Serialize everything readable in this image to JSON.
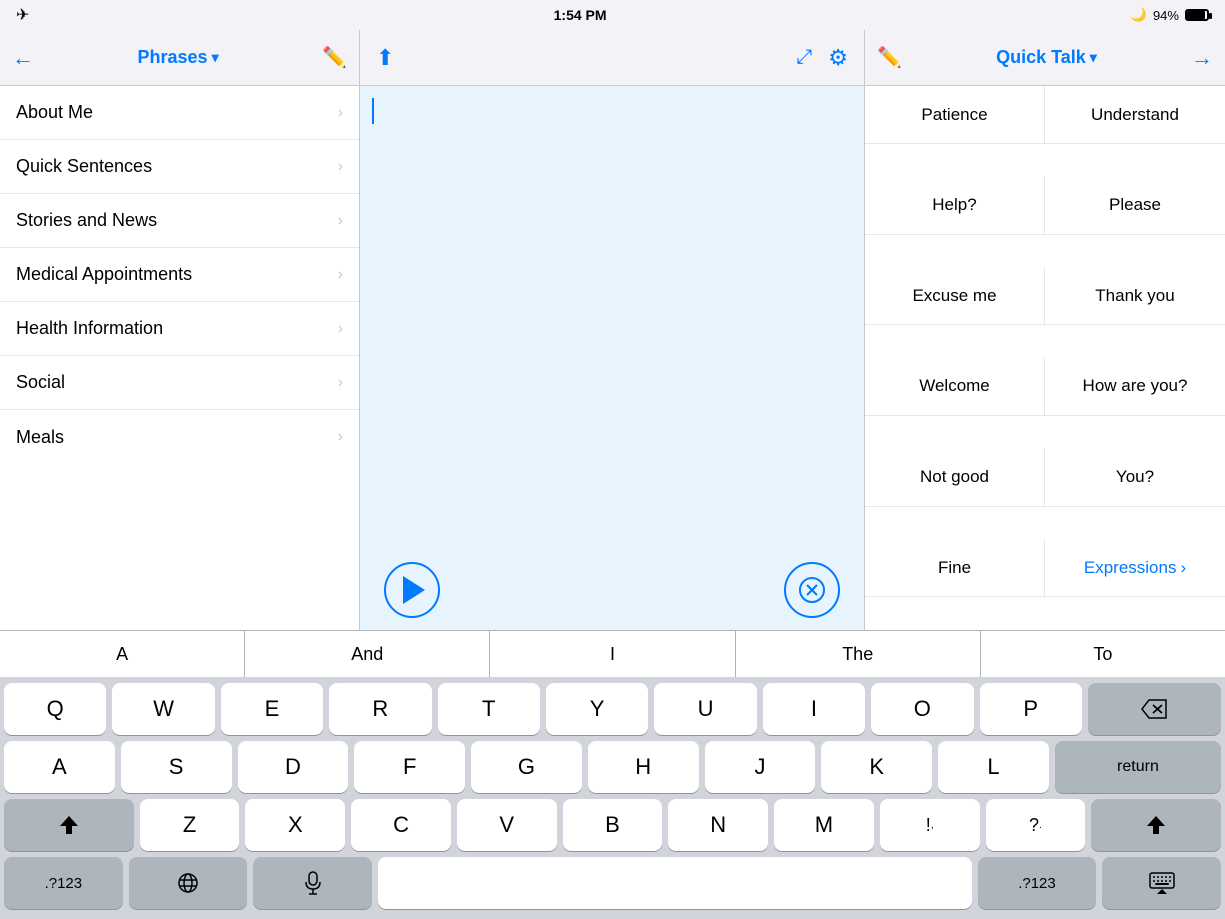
{
  "statusBar": {
    "time": "1:54 PM",
    "battery": "94%",
    "moonIcon": "🌙"
  },
  "leftPanel": {
    "title": "Phrases",
    "editIcon": "✏️",
    "backIcon": "←",
    "navItems": [
      {
        "label": "About Me"
      },
      {
        "label": "Quick Sentences"
      },
      {
        "label": "Stories and News"
      },
      {
        "label": "Medical Appointments"
      },
      {
        "label": "Health Information"
      },
      {
        "label": "Social"
      },
      {
        "label": "Meals"
      }
    ]
  },
  "middlePanel": {
    "shareIcon": "⬆",
    "expandIcon": "⤢",
    "gearIcon": "⚙"
  },
  "rightPanel": {
    "title": "Quick Talk",
    "editIcon": "✏️",
    "forwardIcon": "→",
    "quickTalkItems": [
      {
        "label": "Patience"
      },
      {
        "label": "Understand"
      },
      {
        "label": "Help?"
      },
      {
        "label": "Please"
      },
      {
        "label": "Excuse me"
      },
      {
        "label": "Thank you"
      },
      {
        "label": "Welcome"
      },
      {
        "label": "How are you?"
      },
      {
        "label": "Not good"
      },
      {
        "label": "You?"
      },
      {
        "label": "Fine"
      },
      {
        "label": "Expressions",
        "isLink": true
      }
    ]
  },
  "wordSuggestions": {
    "items": [
      "A",
      "And",
      "I",
      "The",
      "To"
    ]
  },
  "keyboard": {
    "row1": [
      "Q",
      "W",
      "E",
      "R",
      "T",
      "Y",
      "U",
      "I",
      "O",
      "P"
    ],
    "row2": [
      "A",
      "S",
      "D",
      "F",
      "G",
      "H",
      "J",
      "K",
      "L"
    ],
    "row3": [
      "Z",
      "X",
      "C",
      "V",
      "B",
      "N",
      "M",
      "!",
      "?"
    ],
    "backspaceLabel": "⌫",
    "returnLabel": "return",
    "shiftLabel": "▲",
    "numberLabel": ".?123",
    "globeLabel": "🌐",
    "micLabel": "🎤",
    "spaceLabel": "",
    "hideKeyboardLabel": "⌨"
  }
}
